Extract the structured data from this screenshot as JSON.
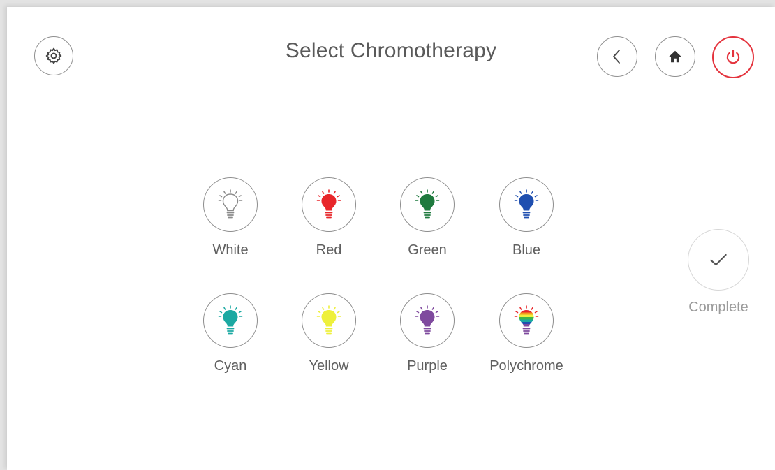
{
  "header": {
    "title": "Select Chromotherapy",
    "icons": {
      "settings": "gear-icon",
      "back": "chevron-left-icon",
      "home": "home-icon",
      "power": "power-icon"
    },
    "power_color": "#e4333d"
  },
  "options": [
    {
      "id": "white",
      "label": "White",
      "color": "#ffffff",
      "outline": true
    },
    {
      "id": "red",
      "label": "Red",
      "color": "#e8262a"
    },
    {
      "id": "green",
      "label": "Green",
      "color": "#1e7a3e"
    },
    {
      "id": "blue",
      "label": "Blue",
      "color": "#1f4fb0"
    },
    {
      "id": "cyan",
      "label": "Cyan",
      "color": "#1ba9a2"
    },
    {
      "id": "yellow",
      "label": "Yellow",
      "color": "#eef03c"
    },
    {
      "id": "purple",
      "label": "Purple",
      "color": "#7f4a9e"
    },
    {
      "id": "polychrome",
      "label": "Polychrome",
      "color": "rainbow"
    }
  ],
  "complete": {
    "label": "Complete",
    "icon": "checkmark-icon"
  }
}
